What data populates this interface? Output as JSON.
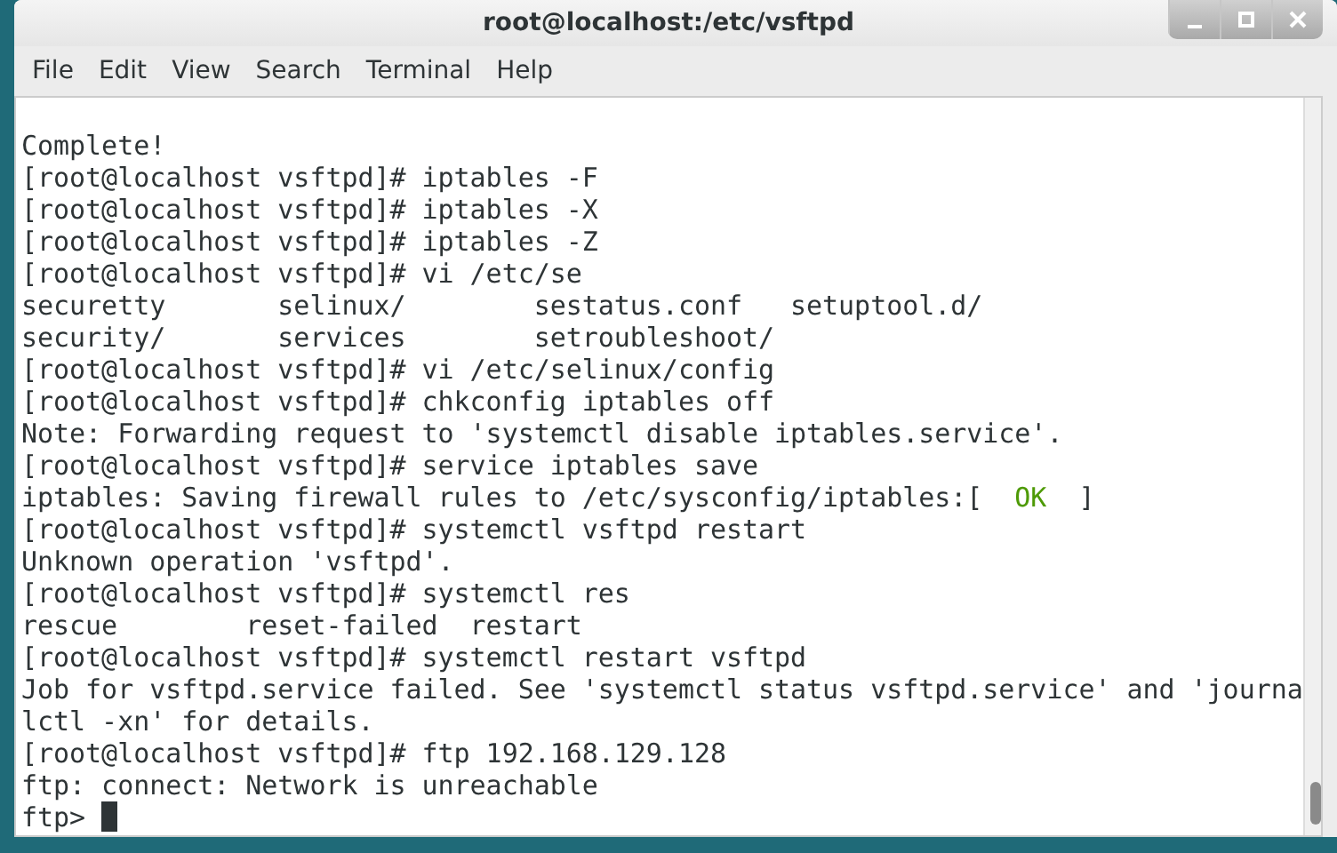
{
  "window": {
    "title": "root@localhost:/etc/vsftpd"
  },
  "menu": [
    "File",
    "Edit",
    "View",
    "Search",
    "Terminal",
    "Help"
  ],
  "terminal": {
    "lines": [
      {
        "kind": "blank"
      },
      {
        "kind": "plain",
        "text": "Complete!"
      },
      {
        "kind": "plain",
        "text": "[root@localhost vsftpd]# iptables -F"
      },
      {
        "kind": "plain",
        "text": "[root@localhost vsftpd]# iptables -X"
      },
      {
        "kind": "plain",
        "text": "[root@localhost vsftpd]# iptables -Z"
      },
      {
        "kind": "plain",
        "text": "[root@localhost vsftpd]# vi /etc/se"
      },
      {
        "kind": "plain",
        "text": "securetty       selinux/        sestatus.conf   setuptool.d/"
      },
      {
        "kind": "plain",
        "text": "security/       services        setroubleshoot/"
      },
      {
        "kind": "plain",
        "text": "[root@localhost vsftpd]# vi /etc/selinux/config"
      },
      {
        "kind": "plain",
        "text": "[root@localhost vsftpd]# chkconfig iptables off"
      },
      {
        "kind": "plain",
        "text": "Note: Forwarding request to 'systemctl disable iptables.service'."
      },
      {
        "kind": "plain",
        "text": "[root@localhost vsftpd]# service iptables save"
      },
      {
        "kind": "status",
        "before": "iptables: Saving firewall rules to /etc/sysconfig/iptables:[  ",
        "status": "OK",
        "after": "  ]"
      },
      {
        "kind": "plain",
        "text": "[root@localhost vsftpd]# systemctl vsftpd restart"
      },
      {
        "kind": "plain",
        "text": "Unknown operation 'vsftpd'."
      },
      {
        "kind": "plain",
        "text": "[root@localhost vsftpd]# systemctl res"
      },
      {
        "kind": "plain",
        "text": "rescue        reset-failed  restart"
      },
      {
        "kind": "plain",
        "text": "[root@localhost vsftpd]# systemctl restart vsftpd"
      },
      {
        "kind": "plain",
        "text": "Job for vsftpd.service failed. See 'systemctl status vsftpd.service' and 'journa"
      },
      {
        "kind": "plain",
        "text": "lctl -xn' for details."
      },
      {
        "kind": "plain",
        "text": "[root@localhost vsftpd]# ftp 192.168.129.128"
      },
      {
        "kind": "plain",
        "text": "ftp: connect: Network is unreachable"
      },
      {
        "kind": "cursor",
        "text": "ftp> "
      }
    ]
  }
}
